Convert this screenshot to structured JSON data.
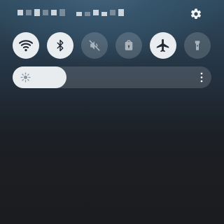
{
  "status": {
    "carrier_icon": "pixelated-carrier-text",
    "settings_icon": "gear-icon"
  },
  "quick_toggles": [
    {
      "name": "wifi",
      "icon": "wifi-icon",
      "state": "on"
    },
    {
      "name": "bluetooth",
      "icon": "bluetooth-icon",
      "state": "on"
    },
    {
      "name": "sound",
      "icon": "mute-icon",
      "state": "off"
    },
    {
      "name": "lock",
      "icon": "lock-icon",
      "state": "off"
    },
    {
      "name": "airplane",
      "icon": "airplane-icon",
      "state": "on"
    },
    {
      "name": "flashlight",
      "icon": "flashlight-icon",
      "state": "off"
    }
  ],
  "brightness": {
    "level": 0.27,
    "icon": "sun-icon",
    "menu_icon": "more-vertical-icon"
  },
  "colors": {
    "toggle_on": "#e9edf0",
    "toggle_off": "rgba(255,255,255,0.16)",
    "icon_on": "#1f2833",
    "icon_off": "#a9b4bd"
  }
}
